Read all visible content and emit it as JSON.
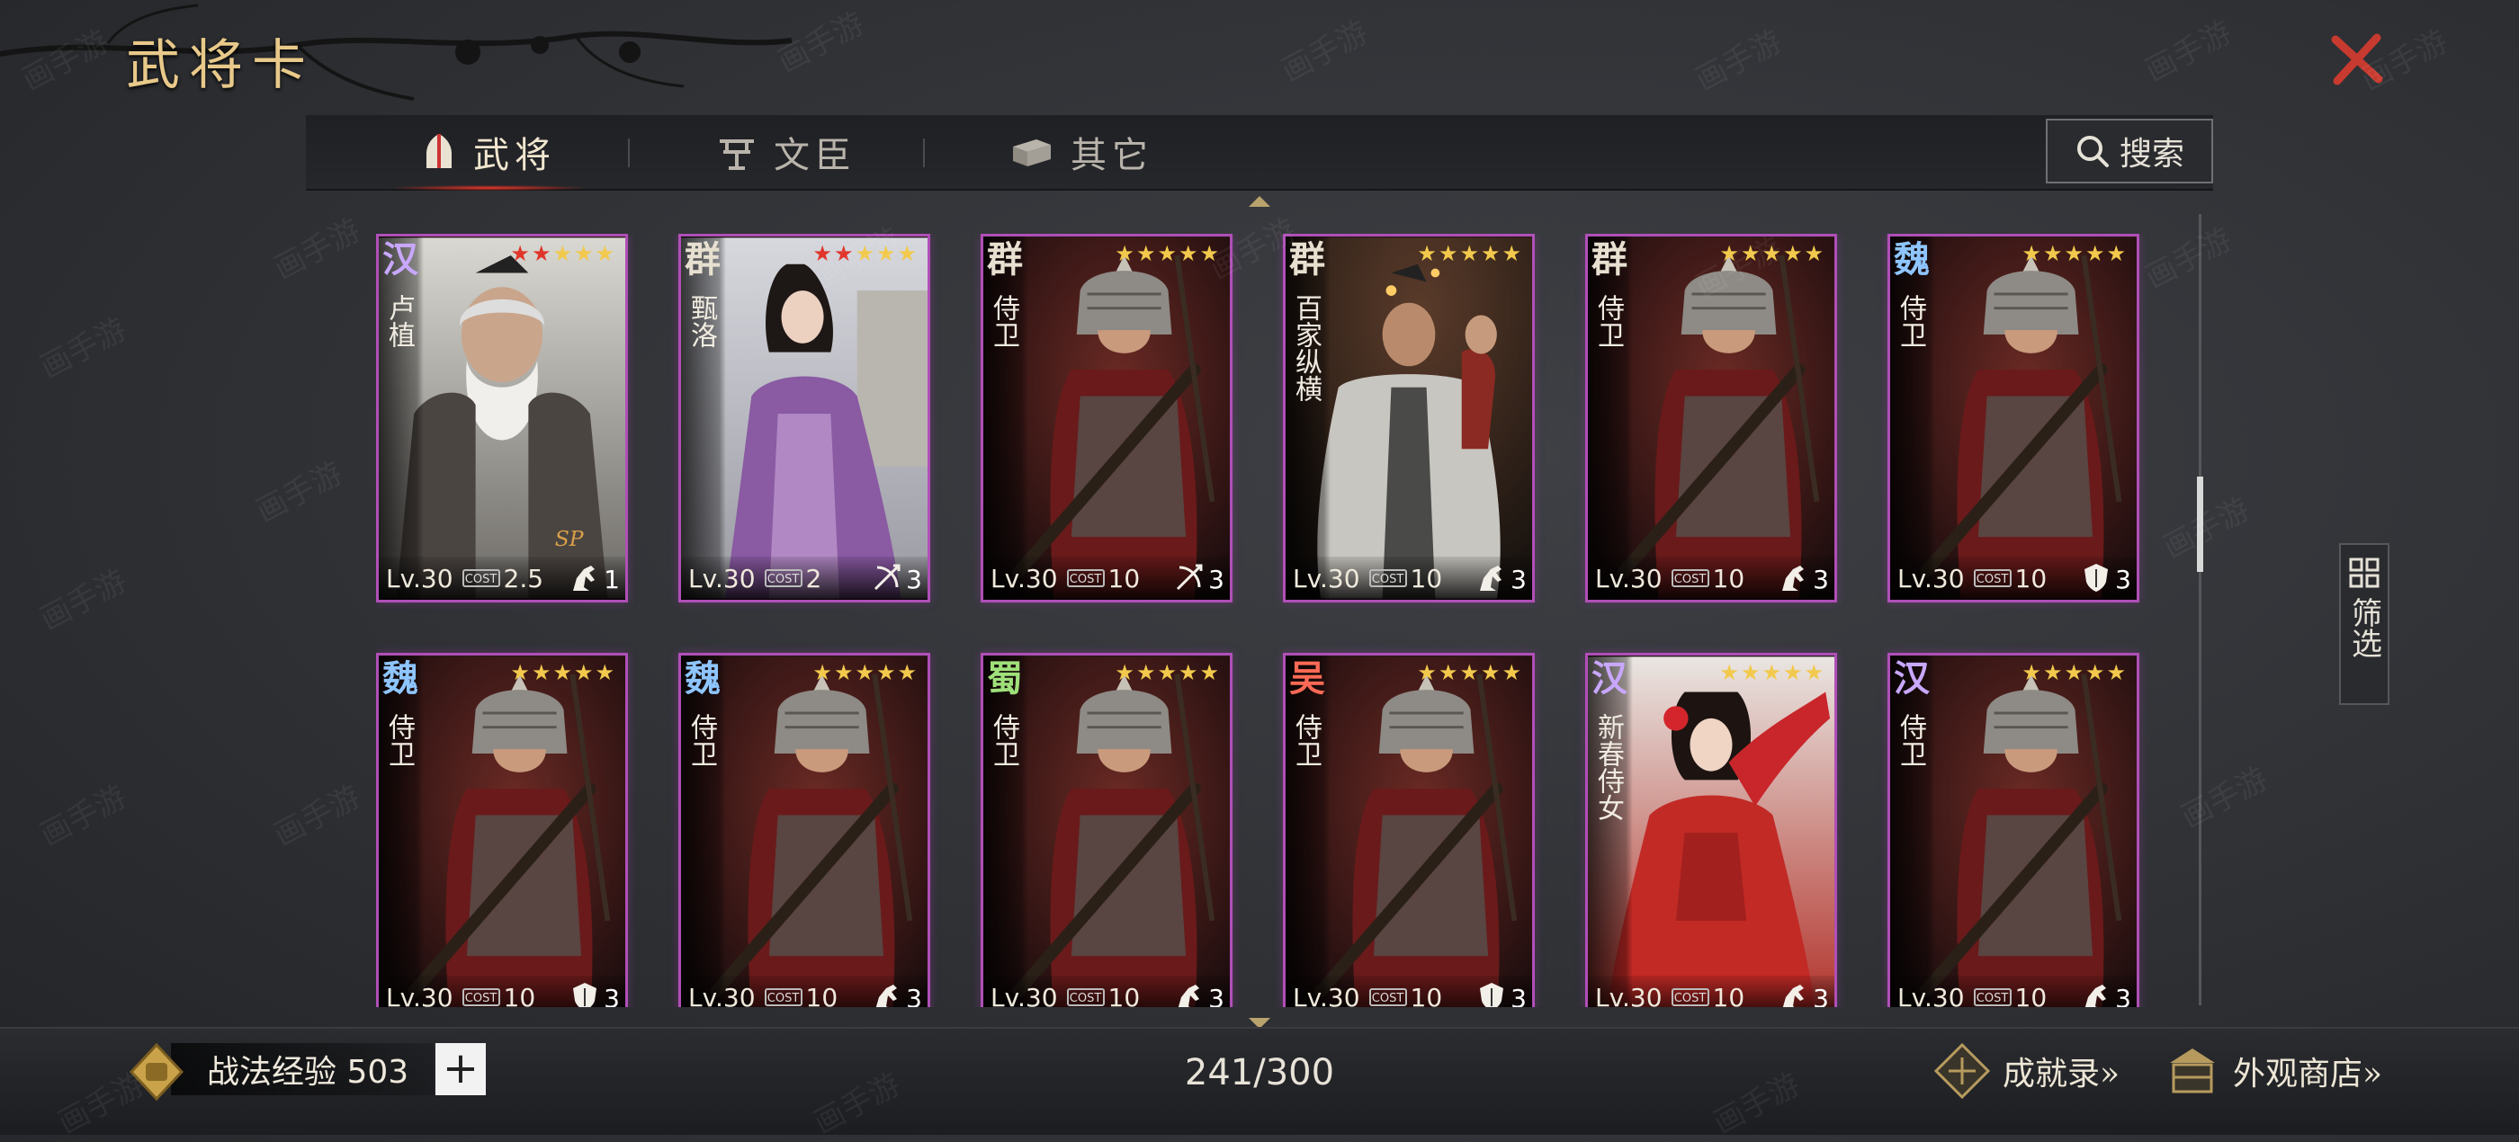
{
  "header": {
    "title": "武将卡"
  },
  "tabs": [
    {
      "label": "武将",
      "active": true
    },
    {
      "label": "文臣",
      "active": false
    },
    {
      "label": "其它",
      "active": false
    }
  ],
  "search": {
    "label": "搜索"
  },
  "filter": {
    "label": "筛选"
  },
  "cards": [
    {
      "faction": "汉",
      "faction_color": "#c8a7ff",
      "name": "卢植",
      "stars_red": 2,
      "stars_total": 5,
      "level": "Lv.30",
      "cost": "2.5",
      "count": "1",
      "type_icon": "cavalry-icon",
      "art": "old-general"
    },
    {
      "faction": "群",
      "faction_color": "#e7e0d0",
      "name": "甄洛",
      "stars_red": 2,
      "stars_total": 5,
      "level": "Lv.30",
      "cost": "2",
      "count": "3",
      "type_icon": "bow-icon",
      "art": "lady-purple"
    },
    {
      "faction": "群",
      "faction_color": "#e7e0d0",
      "name": "侍卫",
      "stars_red": 0,
      "stars_total": 5,
      "level": "Lv.30",
      "cost": "10",
      "count": "3",
      "type_icon": "bow-icon",
      "art": "guard"
    },
    {
      "faction": "群",
      "faction_color": "#e7e0d0",
      "name": "百家纵横",
      "stars_red": 0,
      "stars_total": 5,
      "level": "Lv.30",
      "cost": "10",
      "count": "3",
      "type_icon": "cavalry-icon",
      "art": "scholar"
    },
    {
      "faction": "群",
      "faction_color": "#e7e0d0",
      "name": "侍卫",
      "stars_red": 0,
      "stars_total": 5,
      "level": "Lv.30",
      "cost": "10",
      "count": "3",
      "type_icon": "cavalry-icon",
      "art": "guard"
    },
    {
      "faction": "魏",
      "faction_color": "#8ec5ff",
      "name": "侍卫",
      "stars_red": 0,
      "stars_total": 5,
      "level": "Lv.30",
      "cost": "10",
      "count": "3",
      "type_icon": "shield-icon",
      "art": "guard"
    },
    {
      "faction": "魏",
      "faction_color": "#8ec5ff",
      "name": "侍卫",
      "stars_red": 0,
      "stars_total": 5,
      "level": "Lv.30",
      "cost": "10",
      "count": "3",
      "type_icon": "shield-icon",
      "art": "guard"
    },
    {
      "faction": "魏",
      "faction_color": "#8ec5ff",
      "name": "侍卫",
      "stars_red": 0,
      "stars_total": 5,
      "level": "Lv.30",
      "cost": "10",
      "count": "3",
      "type_icon": "cavalry-icon",
      "art": "guard"
    },
    {
      "faction": "蜀",
      "faction_color": "#9fe07a",
      "name": "侍卫",
      "stars_red": 0,
      "stars_total": 5,
      "level": "Lv.30",
      "cost": "10",
      "count": "3",
      "type_icon": "cavalry-icon",
      "art": "guard"
    },
    {
      "faction": "吴",
      "faction_color": "#ff6a55",
      "name": "侍卫",
      "stars_red": 0,
      "stars_total": 5,
      "level": "Lv.30",
      "cost": "10",
      "count": "3",
      "type_icon": "shield-icon",
      "art": "guard"
    },
    {
      "faction": "汉",
      "faction_color": "#c8a7ff",
      "name": "新春侍女",
      "stars_red": 0,
      "stars_total": 5,
      "level": "Lv.30",
      "cost": "10",
      "count": "3",
      "type_icon": "cavalry-icon",
      "art": "lady-red"
    },
    {
      "faction": "汉",
      "faction_color": "#c8a7ff",
      "name": "侍卫",
      "stars_red": 0,
      "stars_total": 5,
      "level": "Lv.30",
      "cost": "10",
      "count": "3",
      "type_icon": "cavalry-icon",
      "art": "guard"
    }
  ],
  "footer": {
    "exp_label": "战法经验 503",
    "plus_label": "+",
    "capacity": "241/300",
    "achievements_label": "成就录»",
    "shop_label": "外观商店»"
  },
  "watermark": "画手游"
}
